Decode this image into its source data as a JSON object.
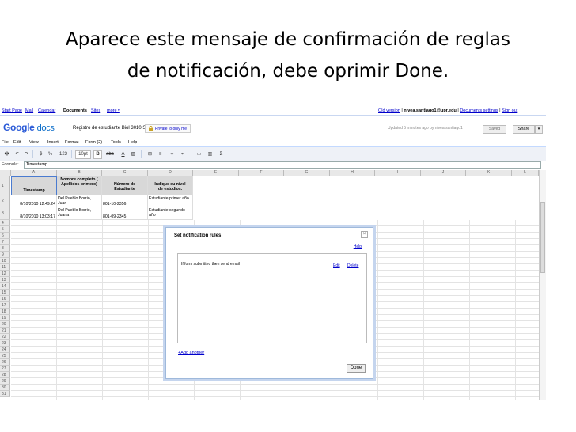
{
  "slide": {
    "title_line1": "Aparece este mensaje de confirmación de reglas",
    "title_line2": "de notificación, debe oprimir Done."
  },
  "topbar": {
    "links": [
      "Start Page",
      "Mail",
      "Calendar",
      "Documents",
      "Sites",
      "more ▾"
    ],
    "account": {
      "old_version": "Old version",
      "email": "nivea.santiago1@upr.edu",
      "settings": "Documents settings",
      "signout": "Sign out"
    }
  },
  "header": {
    "logo_google": "Google",
    "logo_docs": "docs",
    "doc_title": "Registro de estudiante Biol 3010 Sec...",
    "private": "Private to only me",
    "updated": "Updated 5 minutes ago by nivea.santiago1",
    "saved": "Saved",
    "share": "Share"
  },
  "menu": [
    "File",
    "Edit",
    "View",
    "Insert",
    "Format",
    "Form (2)",
    "Tools",
    "Help"
  ],
  "toolbar": {
    "dollar": "$",
    "percent": "%",
    "num": "123",
    "font_size": "10pt",
    "bold": "B",
    "strike": "abc",
    "sigma": "Σ"
  },
  "formula": {
    "label": "Formula:",
    "value": "Timestamp"
  },
  "grid": {
    "columns": [
      "A",
      "B",
      "C",
      "D",
      "E",
      "F",
      "G",
      "H",
      "I",
      "J",
      "K",
      "L"
    ],
    "header_row": [
      "Timestamp",
      "Nombre completo ( Apellidos primero)",
      "Número de Estudiante",
      "Indique su nivel de estudios."
    ],
    "rows": [
      [
        "8/10/2010 12:49:24",
        "Del Pueblo Borrio, Juan",
        "801-10-2356",
        "Estudiante primer año"
      ],
      [
        "8/10/2010 13:03:17",
        "Del Pueblo Borrio, Juana",
        "801-09-2345",
        "Estudiante segundo año"
      ]
    ],
    "row_numbers": [
      "1",
      "2",
      "3",
      "4",
      "5",
      "6",
      "7",
      "8",
      "9",
      "10",
      "11",
      "12",
      "13",
      "14",
      "15",
      "16",
      "17",
      "18",
      "19",
      "20",
      "21",
      "22",
      "23",
      "24",
      "25",
      "26",
      "27",
      "28",
      "29",
      "30",
      "31"
    ]
  },
  "dialog": {
    "title": "Set notification rules",
    "close": "×",
    "help": "Help",
    "rule": "If form submitted then send email",
    "edit": "Edit",
    "delete": "Delete",
    "add_another": "+Add another",
    "done": "Done"
  }
}
